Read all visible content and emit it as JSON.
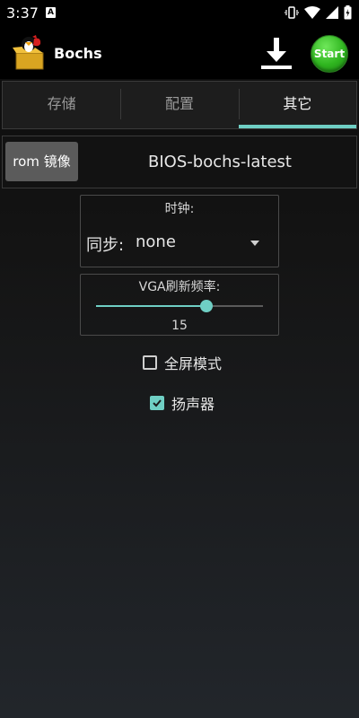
{
  "status_bar": {
    "time": "3:37",
    "notification_glyph": "A"
  },
  "app": {
    "title": "Bochs",
    "start_label": "Start"
  },
  "tabs": [
    {
      "label": "存储",
      "active": false
    },
    {
      "label": "配置",
      "active": false
    },
    {
      "label": "其它",
      "active": true
    }
  ],
  "rom": {
    "button_label": "rom 镜像",
    "value": "BIOS-bochs-latest"
  },
  "clock": {
    "title": "时钟:",
    "sync_label": "同步:",
    "sync_value": "none"
  },
  "vga": {
    "title": "VGA刷新频率:",
    "value": "15",
    "slider_fraction": 0.66
  },
  "options": {
    "fullscreen": {
      "label": "全屏模式",
      "checked": false
    },
    "speaker": {
      "label": "扬声器",
      "checked": true
    }
  },
  "colors": {
    "accent": "#6fcfc4",
    "start_green": "#2fb51f"
  }
}
